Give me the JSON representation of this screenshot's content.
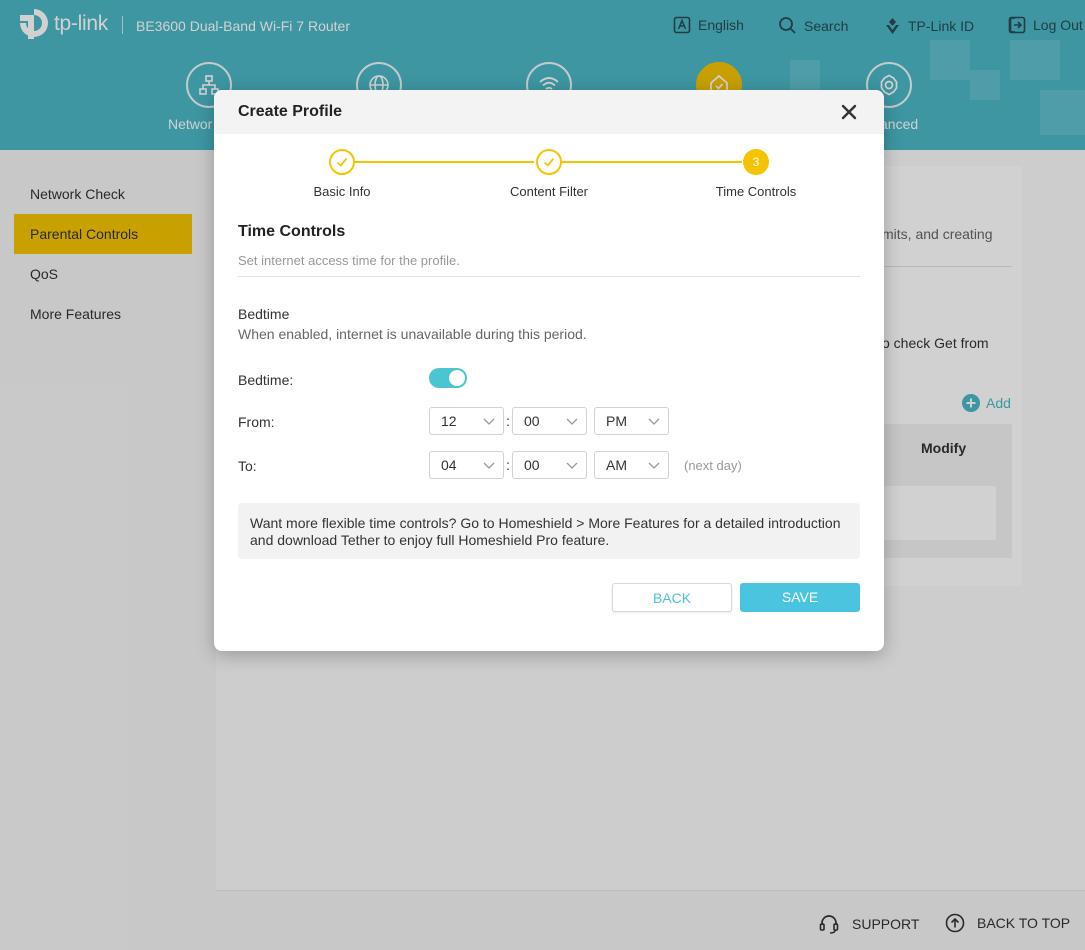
{
  "header": {
    "brand": "tp-link",
    "model": "BE3600 Dual-Band Wi-Fi 7 Router",
    "links": [
      {
        "label": "English",
        "icon": "language-icon"
      },
      {
        "label": "Search",
        "icon": "search-icon"
      },
      {
        "label": "TP-Link ID",
        "icon": "tplink-id-icon"
      },
      {
        "label": "Log Out",
        "icon": "logout-icon"
      }
    ],
    "nav": [
      {
        "label": "Networ",
        "icon": "network-icon"
      },
      {
        "label": "",
        "icon": "internet-icon"
      },
      {
        "label": "",
        "icon": "wireless-icon"
      },
      {
        "label": "",
        "icon": "homeshield-icon",
        "active": true
      },
      {
        "label": "anced",
        "icon": "advanced-gear-icon"
      }
    ]
  },
  "sidebar": {
    "items": [
      {
        "label": "Network Check"
      },
      {
        "label": "Parental Controls",
        "active": true
      },
      {
        "label": "QoS"
      },
      {
        "label": "More Features"
      }
    ]
  },
  "background": {
    "partial_desc": "mits, and creating",
    "partial_check": "o check Get from",
    "add_label": "Add",
    "modify_header": "Modify"
  },
  "footer": {
    "support": "SUPPORT",
    "back_to_top": "BACK TO TOP"
  },
  "modal": {
    "title": "Create Profile",
    "steps": [
      {
        "label": "Basic Info",
        "state": "done"
      },
      {
        "label": "Content Filter",
        "state": "done"
      },
      {
        "label": "Time Controls",
        "state": "current",
        "number": "3"
      }
    ],
    "section_title": "Time Controls",
    "section_desc": "Set internet access time for the profile.",
    "bedtime_title": "Bedtime",
    "bedtime_desc": "When enabled, internet is unavailable during this period.",
    "bedtime_label": "Bedtime:",
    "bedtime_enabled": true,
    "from_label": "From:",
    "to_label": "To:",
    "from": {
      "hour": "12",
      "minute": "00",
      "period": "PM"
    },
    "to": {
      "hour": "04",
      "minute": "00",
      "period": "AM"
    },
    "time_separator": ":",
    "next_day": "(next day)",
    "info": "Want more flexible time controls? Go to Homeshield > More Features for a detailed introduction and download Tether to enjoy full Homeshield Pro feature.",
    "back_label": "BACK",
    "save_label": "SAVE"
  },
  "colors": {
    "header_bg": "#4bb8c6",
    "accent_yellow": "#f5c400",
    "toggle_on": "#4bc5cf",
    "save_button": "#4bc5df"
  }
}
